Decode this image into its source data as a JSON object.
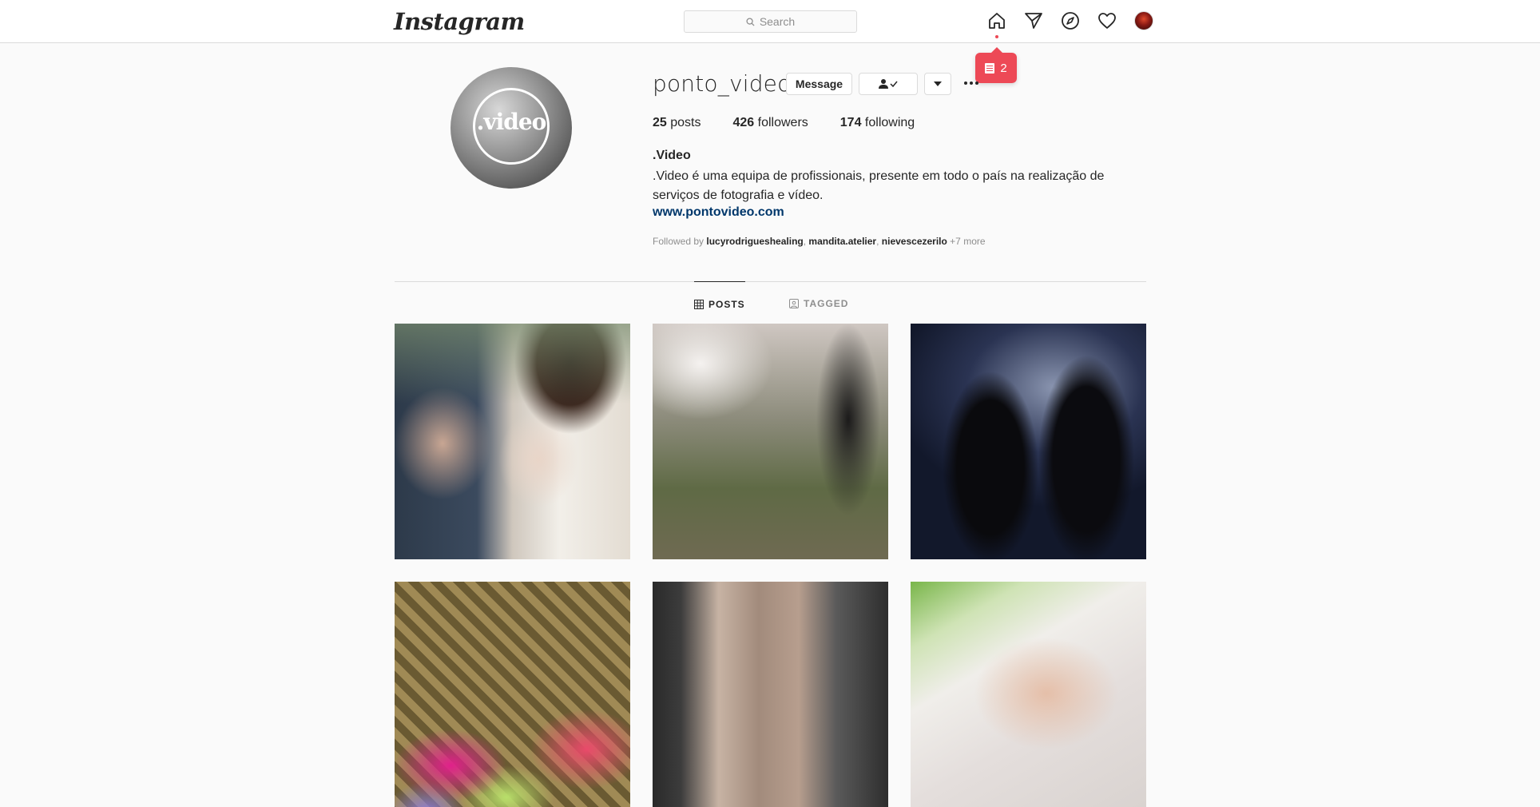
{
  "nav": {
    "logo": "Instagram",
    "search_placeholder": "Search",
    "icons": [
      "home-icon",
      "direct-icon",
      "explore-icon",
      "activity-icon",
      "profile-avatar"
    ]
  },
  "notification": {
    "count": "2"
  },
  "profile": {
    "username": "ponto_video",
    "message_label": "Message",
    "posts_count": "25",
    "posts_label": " posts",
    "followers_count": "426",
    "followers_label": " followers",
    "following_count": "174",
    "following_label": " following",
    "full_name": ".Video",
    "bio": ".Video é uma equipa de profissionais, presente em todo o país na realização de serviços de fotografia e vídeo.",
    "website": "www.pontovideo.com",
    "followed_by_prefix": "Followed by ",
    "followed_by": [
      "lucyrodrigueshealing",
      "mandita.atelier",
      "nievescezerilo"
    ],
    "followed_by_more": " +7 more",
    "picture_text": ".video"
  },
  "tabs": {
    "posts": "POSTS",
    "tagged": "TAGGED"
  },
  "colors": {
    "accent": "#ed4956",
    "link": "#00376b"
  }
}
